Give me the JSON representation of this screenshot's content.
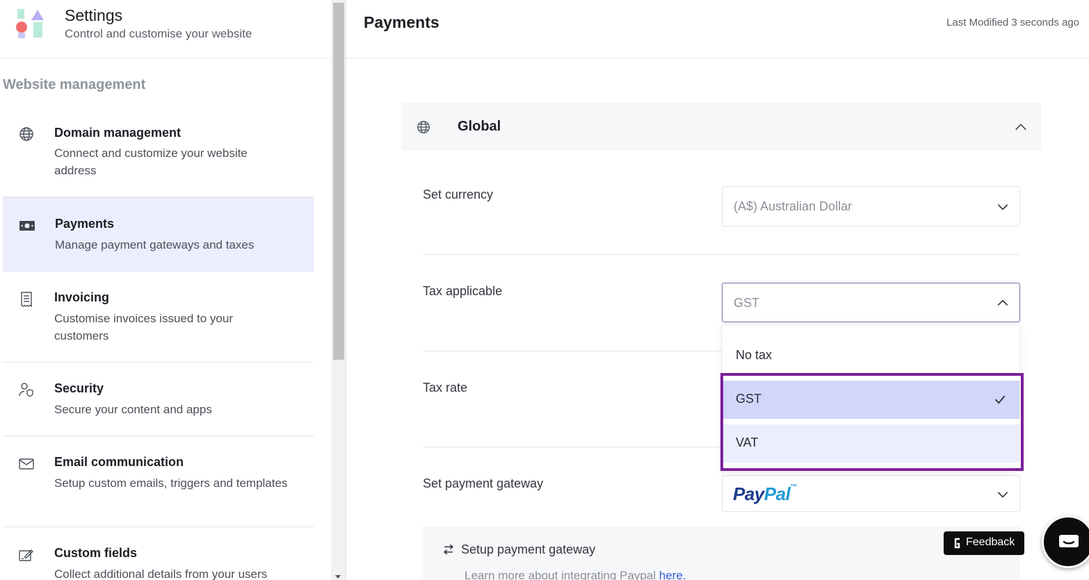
{
  "sidebar": {
    "title": "Settings",
    "subtitle": "Control and customise your website",
    "section_label": "Website management",
    "items": [
      {
        "title": "Domain management",
        "desc": "Connect and customize your website address",
        "icon": "globe-icon"
      },
      {
        "title": "Payments",
        "desc": "Manage payment gateways and taxes",
        "icon": "money-icon",
        "active": true
      },
      {
        "title": "Invoicing",
        "desc": "Customise invoices issued to your customers",
        "icon": "receipt-icon"
      },
      {
        "title": "Security",
        "desc": "Secure your content and apps",
        "icon": "user-shield-icon"
      },
      {
        "title": "Email communication",
        "desc": "Setup custom emails, triggers and templates",
        "icon": "mail-icon"
      },
      {
        "title": "Custom fields",
        "desc": "Collect additional details from your users",
        "icon": "edit-form-icon"
      }
    ]
  },
  "main": {
    "page_title": "Payments",
    "last_modified": "Last Modified 3 seconds ago",
    "section_title": "Global",
    "fields": {
      "currency_label": "Set currency",
      "currency_value": "(A$) Australian Dollar",
      "tax_label": "Tax applicable",
      "tax_value": "GST",
      "tax_rate_label": "Tax rate",
      "gateway_label": "Set payment gateway",
      "gateway_value_pay": "Pay",
      "gateway_value_pal": "Pal",
      "gateway_value_tm": "™"
    },
    "tax_options": [
      {
        "label": "No tax",
        "selected": false
      },
      {
        "label": "GST",
        "selected": true
      },
      {
        "label": "VAT",
        "selected": false
      }
    ],
    "gateway_panel": {
      "title": "Setup payment gateway",
      "learn_text": "Learn more about integrating Paypal ",
      "link_text": "here."
    }
  },
  "feedback_label": "Feedback",
  "colors": {
    "active_nav_bg": "#eceeff",
    "selected_option_bg": "#d2d6fb",
    "highlight_border": "#7b1f9a",
    "paypal_dark": "#1b3a8c",
    "paypal_light": "#1f9ad6"
  }
}
